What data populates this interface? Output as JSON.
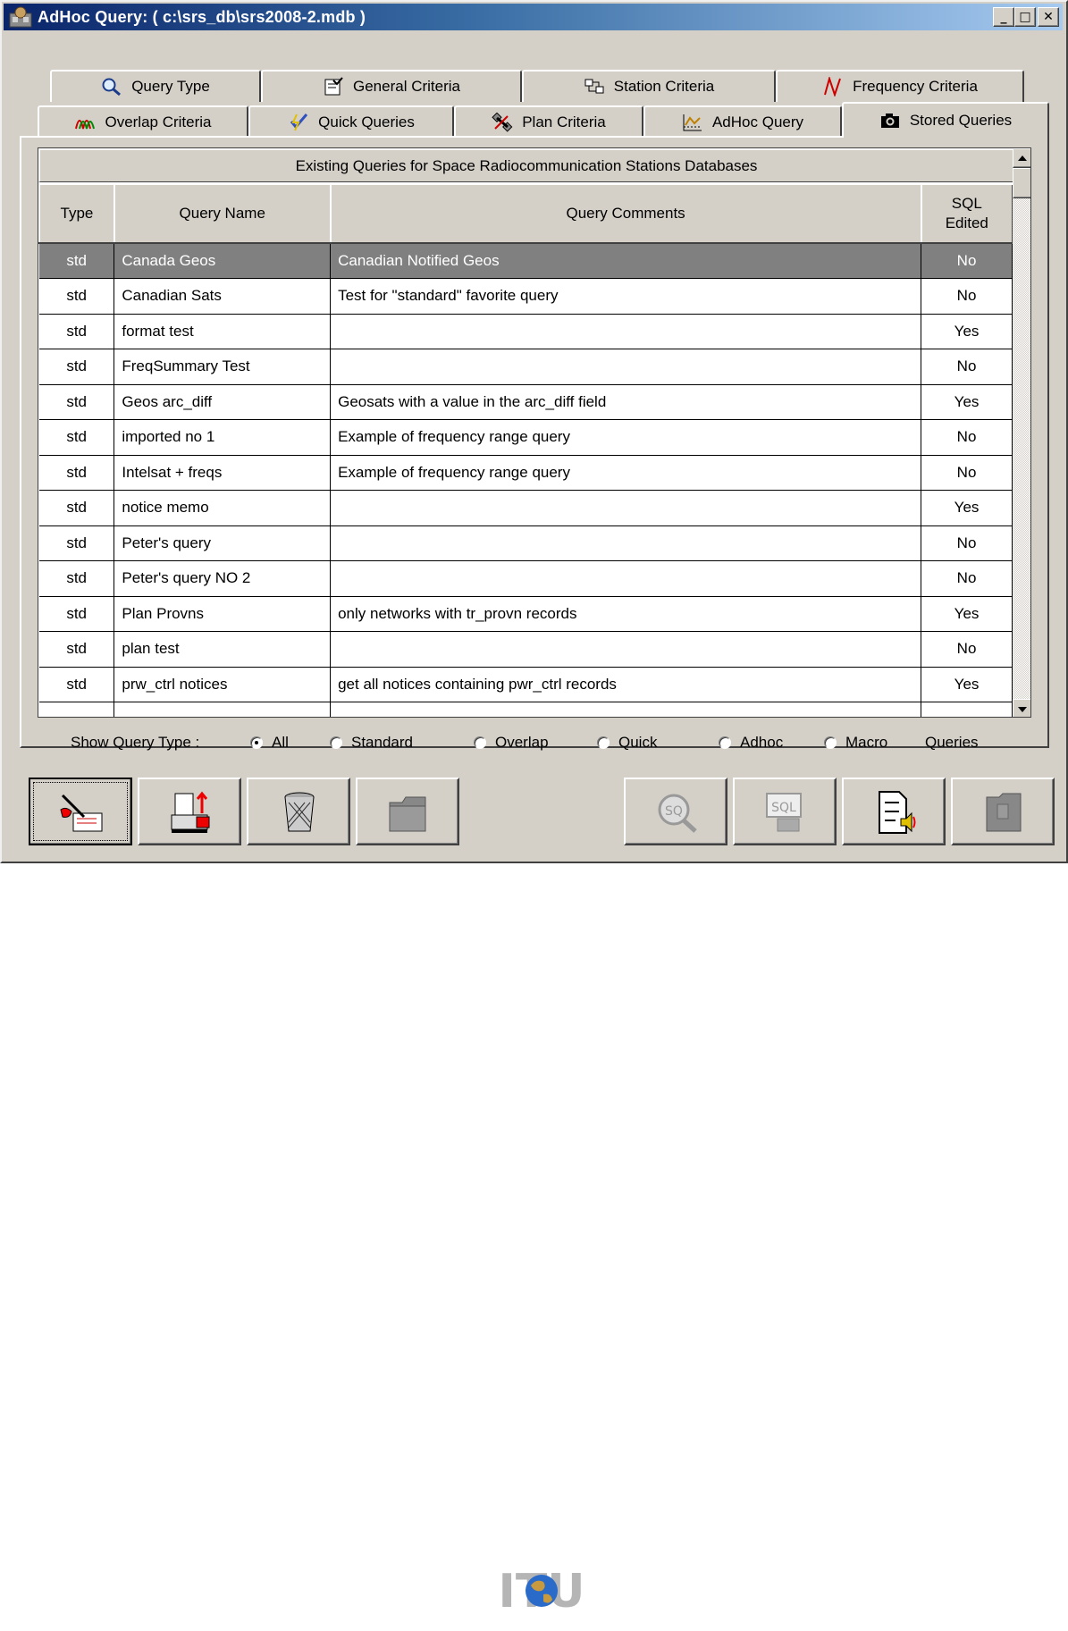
{
  "window": {
    "title": "AdHoc Query:  ( c:\\srs_db\\srs2008-2.mdb )",
    "min_glyph": "_",
    "max_glyph": "□",
    "close_glyph": "✕"
  },
  "tabs_row1": [
    {
      "label": "Query Type",
      "icon": "magnifier-icon"
    },
    {
      "label": "General Criteria",
      "icon": "document-check-icon"
    },
    {
      "label": "Station Criteria",
      "icon": "network-nodes-icon"
    },
    {
      "label": "Frequency Criteria",
      "icon": "waveform-icon"
    }
  ],
  "tabs_row2": [
    {
      "label": "Overlap Criteria",
      "icon": "overlap-waves-icon"
    },
    {
      "label": "Quick Queries",
      "icon": "lightning-check-icon"
    },
    {
      "label": "Plan Criteria",
      "icon": "satellite-icon"
    },
    {
      "label": "AdHoc Query",
      "icon": "chart-icon"
    },
    {
      "label": "Stored Queries",
      "icon": "camera-icon",
      "active": true
    }
  ],
  "grid": {
    "caption": "Existing Queries for Space Radiocommunication Stations Databases",
    "columns": [
      "Type",
      "Query Name",
      "Query Comments",
      "SQL Edited"
    ],
    "rows": [
      {
        "type": "std",
        "name": "Canada Geos",
        "comment": "Canadian Notified Geos",
        "sql": "No",
        "selected": true
      },
      {
        "type": "std",
        "name": "Canadian Sats",
        "comment": "Test for \"standard\" favorite query",
        "sql": "No"
      },
      {
        "type": "std",
        "name": "format test",
        "comment": "",
        "sql": "Yes"
      },
      {
        "type": "std",
        "name": "FreqSummary Test",
        "comment": "",
        "sql": "No"
      },
      {
        "type": "std",
        "name": "Geos arc_diff",
        "comment": "Geosats with a value in the arc_diff field",
        "sql": "Yes"
      },
      {
        "type": "std",
        "name": "imported no 1",
        "comment": "Example of frequency range query",
        "sql": "No"
      },
      {
        "type": "std",
        "name": "Intelsat + freqs",
        "comment": "Example of frequency range query",
        "sql": "No"
      },
      {
        "type": "std",
        "name": "notice memo",
        "comment": "",
        "sql": "Yes"
      },
      {
        "type": "std",
        "name": "Peter's query",
        "comment": "",
        "sql": "No"
      },
      {
        "type": "std",
        "name": "Peter's query   NO 2",
        "comment": "",
        "sql": "No"
      },
      {
        "type": "std",
        "name": "Plan Provns",
        "comment": "only networks with tr_provn records",
        "sql": "Yes"
      },
      {
        "type": "std",
        "name": "plan test",
        "comment": "",
        "sql": "No"
      },
      {
        "type": "std",
        "name": "prw_ctrl notices",
        "comment": "get all notices containing pwr_ctrl records",
        "sql": "Yes"
      }
    ]
  },
  "filter": {
    "label": "Show Query Type :",
    "options": [
      "All",
      "Standard",
      "Overlap",
      "Quick",
      "Adhoc",
      "Macro"
    ],
    "selected": "All",
    "suffix": "Queries"
  },
  "toolbar": {
    "buttons": [
      {
        "icon": "edit-query-icon"
      },
      {
        "icon": "export-printer-icon"
      },
      {
        "icon": "trash-icon"
      },
      {
        "icon": "folder-icon"
      },
      {
        "icon": "run-sq-icon"
      },
      {
        "icon": "sql-icon"
      },
      {
        "icon": "report-audio-icon"
      },
      {
        "icon": "file-icon"
      }
    ],
    "logo_text": "ITU"
  },
  "colors": {
    "face": "#d4d0c8",
    "title_start": "#0a246a",
    "title_end": "#a6caf0",
    "selected_row": "#808080"
  }
}
